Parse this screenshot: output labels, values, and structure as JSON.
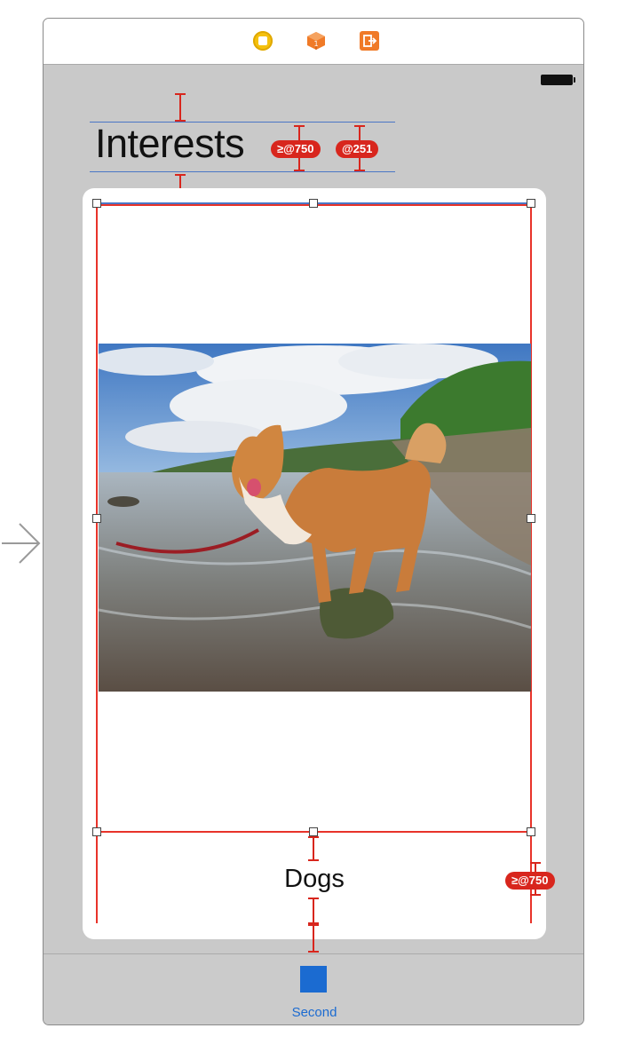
{
  "scene": {
    "title": "Interests",
    "constraint_badges": [
      "≥@750",
      "@251",
      "≥@750"
    ],
    "caption": "Dogs",
    "tab_item": {
      "label": "Second",
      "icon": "square-icon",
      "color": "#1b6bd1"
    },
    "dock_icons": [
      "view-controller-icon",
      "first-responder-icon",
      "exit-icon"
    ],
    "colors": {
      "constraint": "#d8261d",
      "guide": "#4a76c5",
      "scene_background": "#c9c9c9"
    }
  }
}
